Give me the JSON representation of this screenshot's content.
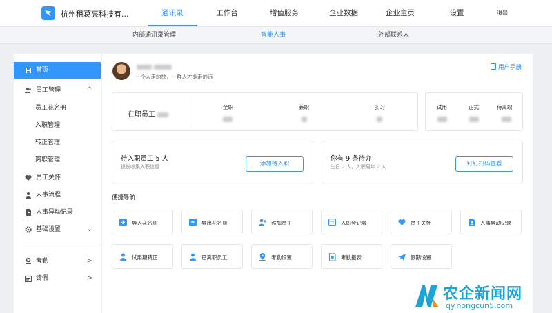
{
  "topbar": {
    "company": "杭州租葛亮科技有...",
    "nav": [
      "通讯录",
      "工作台",
      "增值服务",
      "企业数据",
      "企业主页",
      "设置",
      "退出"
    ],
    "active_nav": "通讯录"
  },
  "subnav": {
    "items": [
      "内部通讯录管理",
      "智能人事",
      "外部联系人"
    ],
    "active": "智能人事"
  },
  "sidebar": {
    "items": [
      {
        "label": "首页",
        "icon": "home-icon"
      },
      {
        "label": "员工管理",
        "icon": "users-icon",
        "arrow": "^"
      },
      {
        "label": "员工花名册"
      },
      {
        "label": "入职管理"
      },
      {
        "label": "转正管理"
      },
      {
        "label": "离职管理"
      },
      {
        "label": "员工关怀",
        "icon": "heart-icon"
      },
      {
        "label": "人事流程",
        "icon": "user-flow-icon"
      },
      {
        "label": "人事异动记录",
        "icon": "record-icon"
      },
      {
        "label": "基础设置",
        "icon": "gear-icon",
        "arrow": "⌄"
      },
      {
        "label": "考勤",
        "icon": "attendance-icon",
        "arrow": ">"
      },
      {
        "label": "请假",
        "icon": "leave-icon",
        "arrow": ">"
      }
    ]
  },
  "profile": {
    "motto": "一个人走的快，一群人才能走的远",
    "manual_link": "用户手册"
  },
  "stats": {
    "title": "在职员工",
    "groups": [
      {
        "label": "全职"
      },
      {
        "label": "兼职"
      },
      {
        "label": "实习"
      },
      {
        "label": "试用"
      },
      {
        "label": "正式"
      },
      {
        "label": "待离职"
      }
    ]
  },
  "onboarding": {
    "title": "待入职员工 5 人",
    "subtitle": "提前收集入职信息",
    "button": "添加待入职"
  },
  "todo": {
    "title": "你有 9 条待办",
    "subtitle": "生日 2 人，入职周年 2 人",
    "button": "钉钉扫码查看"
  },
  "shortcuts": {
    "title": "便捷导航",
    "items": [
      {
        "label": "导入花名册",
        "icon": "import-icon"
      },
      {
        "label": "导出花名册",
        "icon": "export-icon"
      },
      {
        "label": "添加员工",
        "icon": "add-user-icon"
      },
      {
        "label": "入职登记表",
        "icon": "form-icon"
      },
      {
        "label": "员工关怀",
        "icon": "heart-icon"
      },
      {
        "label": "人事异动记录",
        "icon": "record-icon"
      },
      {
        "label": "试用期转正",
        "icon": "user-icon"
      },
      {
        "label": "已离职员工",
        "icon": "user-icon"
      },
      {
        "label": "考勤设置",
        "icon": "location-icon"
      },
      {
        "label": "考勤报表",
        "icon": "report-icon"
      },
      {
        "label": "假期设置",
        "icon": "plane-icon"
      }
    ]
  },
  "watermark": {
    "text": "农企新闻网",
    "url": "qy.nongcun5.com"
  },
  "colors": {
    "accent": "#3296fa",
    "background": "#eef0f3",
    "watermark": "#1aa4d8"
  }
}
